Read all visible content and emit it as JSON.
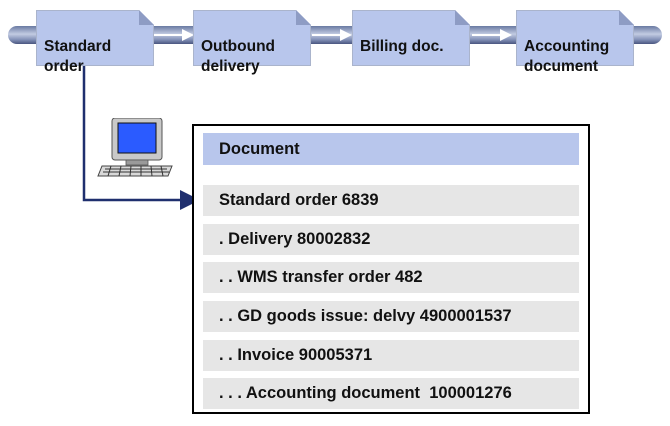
{
  "process_flow": {
    "stages": [
      {
        "label": "Standard\norder"
      },
      {
        "label": "Outbound\ndelivery"
      },
      {
        "label": "Billing doc."
      },
      {
        "label": "Accounting\ndocument"
      }
    ]
  },
  "document_flow": {
    "header": "Document",
    "rows": [
      {
        "label": "Standard order 6839"
      },
      {
        "label": ". Delivery 80002832"
      },
      {
        "label": ". . WMS transfer order 482"
      },
      {
        "label": ". . GD goods issue: delvy 4900001537"
      },
      {
        "label": ". . Invoice 90005371"
      },
      {
        "label": ". . . Accounting document  100001276"
      }
    ]
  },
  "colors": {
    "stage_fill": "#b8c6ec",
    "row_fill": "#e6e6e6",
    "connector": "#1f2f6e"
  }
}
